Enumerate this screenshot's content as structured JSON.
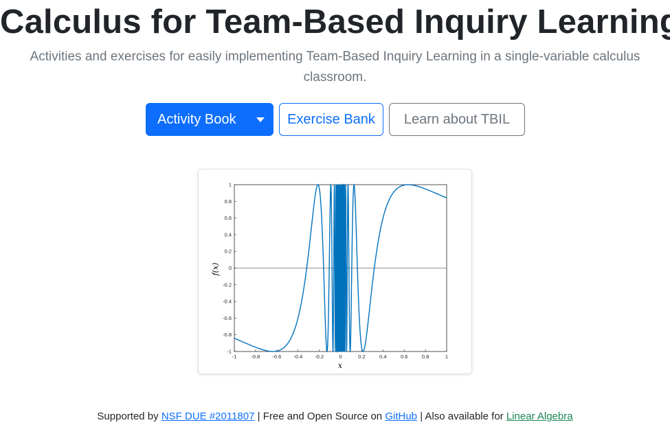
{
  "header": {
    "title": "Calculus for Team-Based Inquiry Learning",
    "lead": "Activities and exercises for easily implementing Team-Based Inquiry Learning in a single-variable calculus classroom."
  },
  "buttons": {
    "activity_book": "Activity Book",
    "exercise_bank": "Exercise Bank",
    "learn_tbil": "Learn about TBIL"
  },
  "colors": {
    "primary": "#0d6efd",
    "secondary": "#6c757d",
    "green_link": "#198754",
    "curve": "#0072bd"
  },
  "footer": {
    "supported_by": "Supported by",
    "nsf_link": "NSF DUE #2011807",
    "sep1": "| Free and Open Source on",
    "github_link": "GitHub",
    "sep2": "| Also available for",
    "linear_algebra_link": "Linear Algebra"
  },
  "chart_data": {
    "type": "line",
    "function": "sin(1/x)",
    "xlabel": "x",
    "ylabel": "f(x)",
    "xlim": [
      -1,
      1
    ],
    "ylim": [
      -1,
      1
    ],
    "xticks": [
      "-1",
      "-0.8",
      "-0.6",
      "-0.4",
      "-0.2",
      "0",
      "0.2",
      "0.4",
      "0.6",
      "0.8",
      "1"
    ],
    "yticks": [
      "1",
      "0.8",
      "0.6",
      "0.4",
      "0.2",
      "0",
      "-0.2",
      "-0.4",
      "-0.6",
      "-0.8",
      "-1"
    ],
    "zero_line": true
  }
}
